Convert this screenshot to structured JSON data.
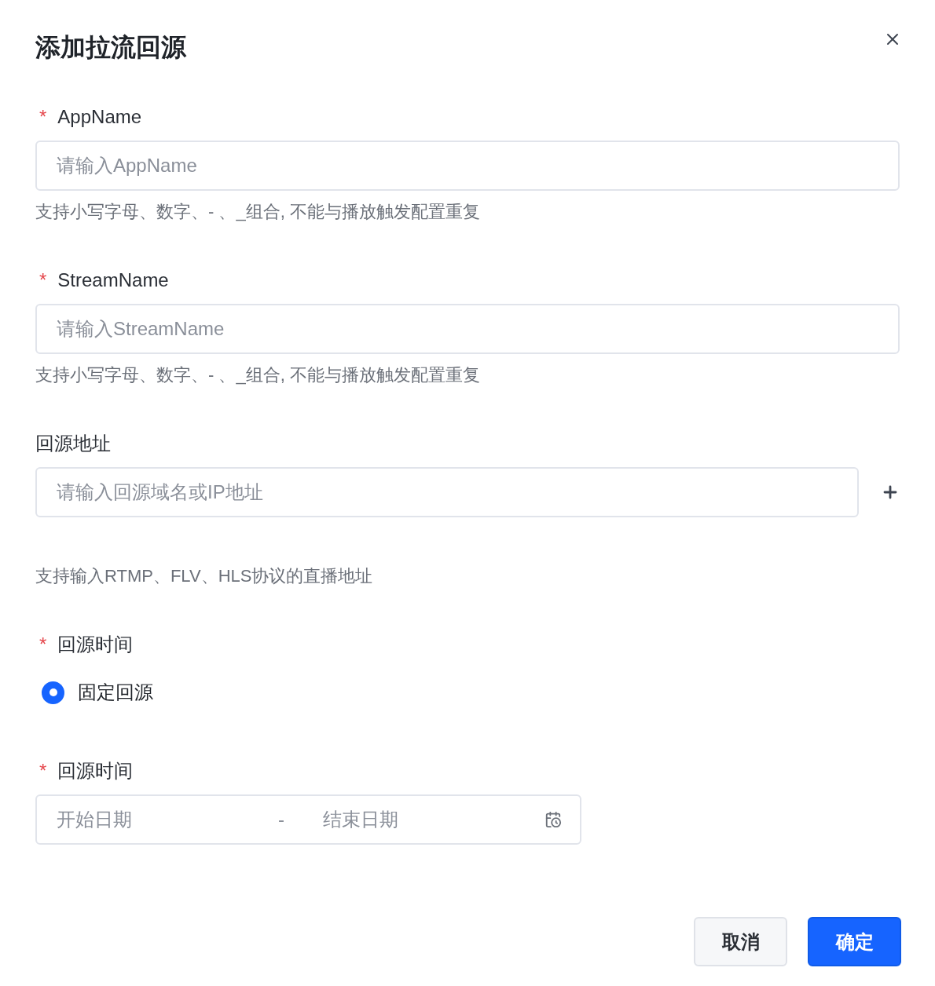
{
  "dialog": {
    "title": "添加拉流回源"
  },
  "fields": [
    {
      "kind": "text",
      "label": "AppName",
      "required_mark": "*",
      "placeholder": "请输入AppName",
      "hint": "支持小写字母、数字、- 、_组合, 不能与播放触发配置重复"
    },
    {
      "kind": "text",
      "label": "StreamName",
      "required_mark": "*",
      "placeholder": "请输入StreamName",
      "hint": "支持小写字母、数字、- 、_组合, 不能与播放触发配置重复"
    },
    {
      "kind": "address",
      "label": "回源地址",
      "placeholder": "请输入回源域名或IP地址",
      "hint": "支持输入RTMP、FLV、HLS协议的直播地址"
    },
    {
      "kind": "radio",
      "label": "回源时间",
      "required_mark": "*",
      "options": [
        {
          "label": "固定回源",
          "selected": true
        }
      ]
    },
    {
      "kind": "daterange",
      "label": "回源时间",
      "required_mark": "*",
      "start_placeholder": "开始日期",
      "separator": "-",
      "end_placeholder": "结束日期"
    }
  ],
  "buttons": [
    {
      "label": "取消",
      "kind": "secondary"
    },
    {
      "label": "确定",
      "kind": "primary"
    }
  ]
}
